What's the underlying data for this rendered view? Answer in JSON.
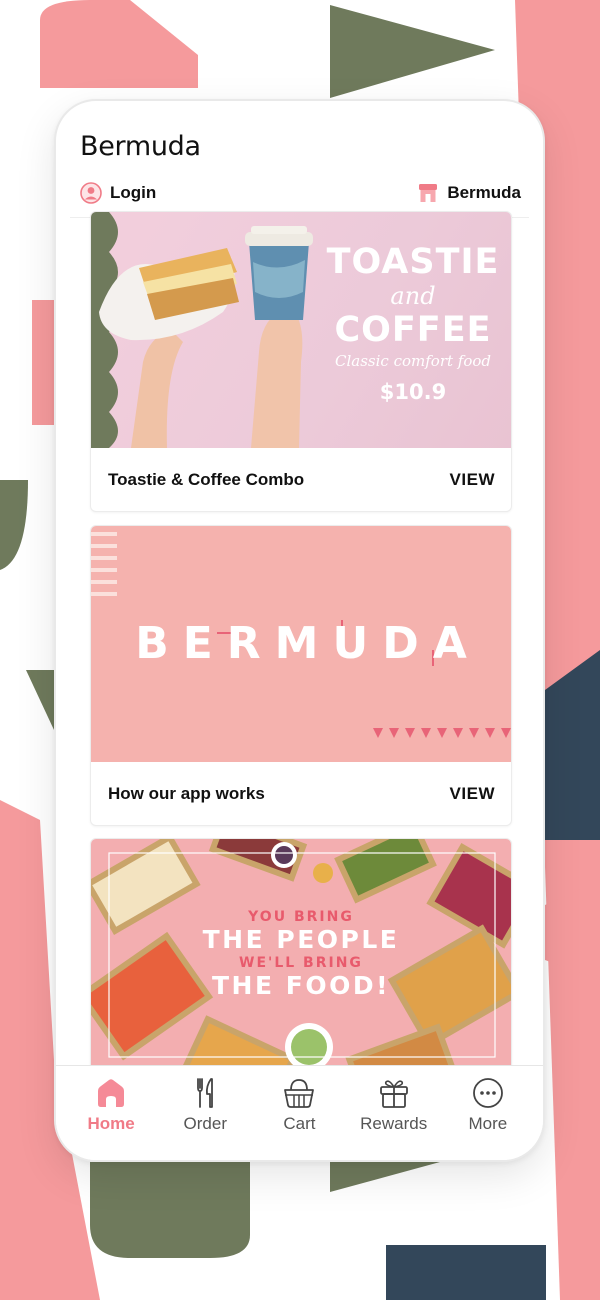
{
  "app": {
    "title": "Bermuda"
  },
  "topbar": {
    "login_label": "Login",
    "store_label": "Bermuda"
  },
  "cards": [
    {
      "title": "Toastie & Coffee Combo",
      "action": "VIEW",
      "promo": {
        "line1": "TOASTIE",
        "line2": "and",
        "line3": "COFFEE",
        "tagline": "Classic comfort food",
        "price": "$10.9"
      }
    },
    {
      "title": "How our app works",
      "action": "VIEW",
      "brand": "BERMUDA"
    },
    {
      "promo": {
        "line1": "YOU BRING",
        "line2": "THE PEOPLE",
        "line3": "WE'LL BRING",
        "line4": "THE FOOD!"
      }
    }
  ],
  "nav": [
    {
      "label": "Home",
      "icon": "home-icon",
      "active": true
    },
    {
      "label": "Order",
      "icon": "fork-knife-icon",
      "active": false
    },
    {
      "label": "Cart",
      "icon": "basket-icon",
      "active": false
    },
    {
      "label": "Rewards",
      "icon": "gift-icon",
      "active": false
    },
    {
      "label": "More",
      "icon": "more-dots-icon",
      "active": false
    }
  ],
  "colors": {
    "accent": "#f07b87",
    "pink_bg": "#f5b2ae",
    "olive": "#6f7a5c",
    "navy": "#33475a"
  }
}
